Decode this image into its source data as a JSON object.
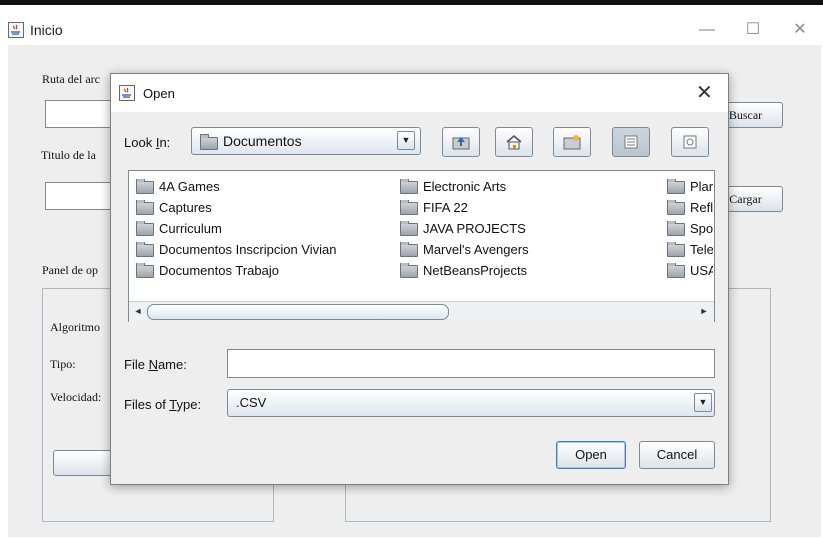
{
  "window": {
    "title": "Inicio"
  },
  "form": {
    "ruta_label": "Ruta del arc",
    "titulo_label": "Titulo de la",
    "buscar_label": "Buscar",
    "cargar_label": "Cargar",
    "panel_label": "Panel de op",
    "algoritmo_label": "Algoritmo",
    "tipo_label": "Tipo:",
    "velocidad_label": "Velocidad:"
  },
  "dialog": {
    "title": "Open",
    "look_in_label_pre": "Look ",
    "look_in_label_mnemonic": "I",
    "look_in_label_post": "n:",
    "look_in_value": "Documentos",
    "toolbar_icons": [
      "up-folder-icon",
      "home-icon",
      "new-folder-icon",
      "list-view-icon",
      "details-view-icon"
    ],
    "files": [
      "4A Games",
      "Captures",
      "Curriculum",
      "Documentos Inscripcion Vivian",
      "Documentos Trabajo",
      "Electronic Arts",
      "FIFA 22",
      "JAVA PROJECTS",
      "Marvel's Avengers",
      "NetBeansProjects",
      "Plar",
      "Refl",
      "Spo",
      "Tele",
      "USA"
    ],
    "file_name_label_pre": "File ",
    "file_name_label_mnemonic": "N",
    "file_name_label_post": "ame:",
    "file_name_value": "",
    "files_of_type_label_pre": "Files of ",
    "files_of_type_label_mnemonic": "T",
    "files_of_type_label_post": "ype:",
    "files_of_type_value": ".CSV",
    "open_label": "Open",
    "cancel_label": "Cancel"
  }
}
